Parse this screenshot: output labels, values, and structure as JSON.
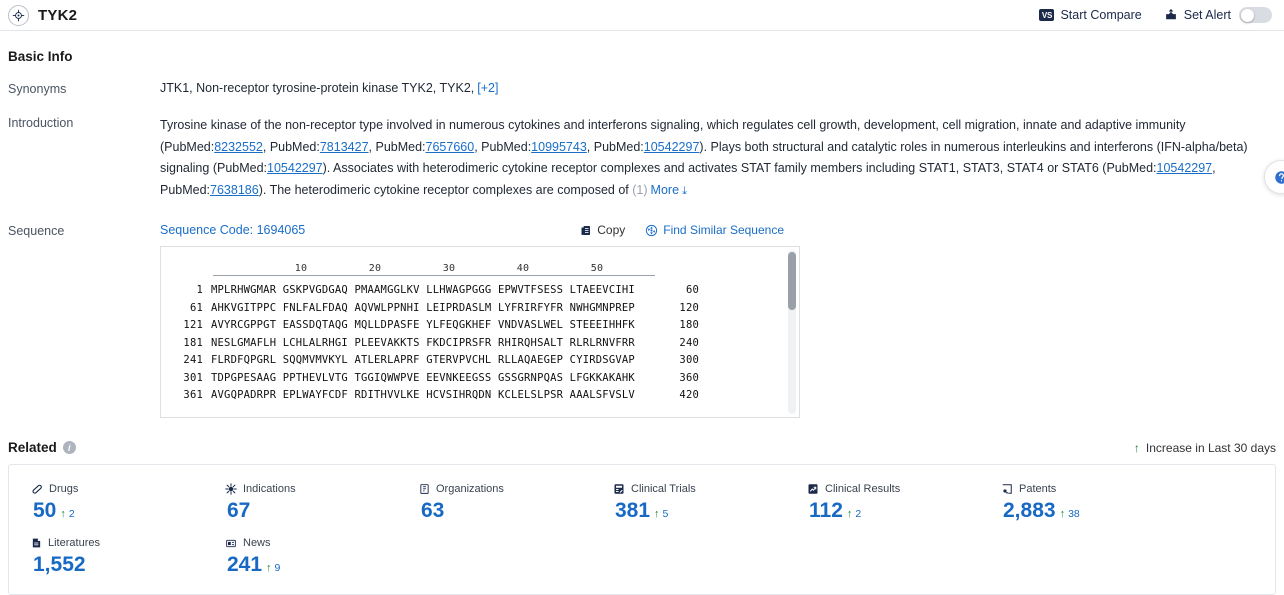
{
  "header": {
    "logo_icon": "target-crosshair-icon",
    "title": "TYK2",
    "actions": [
      {
        "label": "Start Compare",
        "icon": "vs-icon",
        "badge": "VS"
      },
      {
        "label": "Set Alert",
        "icon": "alert-bell-icon"
      }
    ],
    "alert_toggle_state": "off"
  },
  "basic_info": {
    "section_title": "Basic Info",
    "synonyms": {
      "label": "Synonyms",
      "value": "JTK1,  Non-receptor tyrosine-protein kinase TYK2,  TYK2,",
      "more_label": "[+2]"
    },
    "introduction": {
      "label": "Introduction",
      "text_1": "Tyrosine kinase of the non-receptor type involved in numerous cytokines and interferons signaling, which regulates cell growth, development, cell migration, innate and adaptive immunity (PubMed:",
      "ref_1": "8232552",
      "text_2": ", PubMed:",
      "ref_2": "7813427",
      "text_3": ", PubMed:",
      "ref_3": "7657660",
      "text_4": ", PubMed:",
      "ref_4": "10995743",
      "text_5": ", PubMed:",
      "ref_5": "10542297",
      "text_6": "). Plays both structural and catalytic roles in numerous interleukins and interferons (IFN-alpha/beta) signaling (PubMed:",
      "ref_6": "10542297",
      "text_7": "). Associates with heterodimeric cytokine receptor complexes and activates STAT family members including STAT1, STAT3, STAT4 or STAT6 (PubMed:",
      "ref_7": "10542297",
      "text_8": ", PubMed:",
      "ref_8": "7638186",
      "text_9": "). The heterodimeric cytokine receptor complexes are composed of ",
      "hidden_count": "(1)",
      "more_label": "More",
      "chevron": "chevron-double-down-icon"
    },
    "sequence": {
      "label": "Sequence",
      "code_label": "Sequence Code: 1694065",
      "copy_label": "Copy",
      "copy_icon": "copy-icon",
      "find_similar_label": "Find Similar Sequence",
      "find_similar_icon": "find-similar-icon",
      "ruler": [
        "10",
        "20",
        "30",
        "40",
        "50"
      ],
      "lines": [
        {
          "start": "1",
          "chunks": "MPLRHWGMAR GSKPVGDGAQ PMAAMGGLKV LLHWAGPGGG EPWVTFSESS LTAEEVCIHI",
          "end": "60"
        },
        {
          "start": "61",
          "chunks": "AHKVGITPPC FNLFALFDAQ AQVWLPPNHI LEIPRDASLM LYFRIRFYFR NWHGMNPREP",
          "end": "120"
        },
        {
          "start": "121",
          "chunks": "AVYRCGPPGT EASSDQTAQG MQLLDPASFE YLFEQGKHEF VNDVASLWEL STEEEIHHFK",
          "end": "180"
        },
        {
          "start": "181",
          "chunks": "NESLGMAFLH LCHLALRHGI PLEEVAKKTS FKDCIPRSFR RHIRQHSALT RLRLRNVFRR",
          "end": "240"
        },
        {
          "start": "241",
          "chunks": "FLRDFQPGRL SQQMVMVKYL ATLERLAPRF GTERVPVCHL RLLAQAEGEP CYIRDSGVAP",
          "end": "300"
        },
        {
          "start": "301",
          "chunks": "TDPGPESAAG PPTHEVLVTG TGGIQWWPVE EEVNKEEGSS GSSGRNPQAS LFGKKAKAHK",
          "end": "360"
        },
        {
          "start": "361",
          "chunks": "AVGQPADRPR EPLWAYFCDF RDITHVVLKE HCVSIHRQDN KCLELSLPSR AAALSFVSLV",
          "end": "420"
        }
      ]
    }
  },
  "related": {
    "section_title": "Related",
    "info_icon": "info-icon",
    "legend": "Increase in Last 30 days",
    "legend_icon": "up-arrow-icon",
    "stats": [
      {
        "label": "Drugs",
        "icon": "pill-icon",
        "value": "50",
        "delta": "2"
      },
      {
        "label": "Indications",
        "icon": "virus-icon",
        "value": "67",
        "delta": ""
      },
      {
        "label": "Organizations",
        "icon": "building-icon",
        "value": "63",
        "delta": ""
      },
      {
        "label": "Clinical Trials",
        "icon": "clinical-trial-icon",
        "value": "381",
        "delta": "5"
      },
      {
        "label": "Clinical Results",
        "icon": "clinical-result-icon",
        "value": "112",
        "delta": "2"
      },
      {
        "label": "Patents",
        "icon": "patent-icon",
        "value": "2,883",
        "delta": "38"
      },
      {
        "label": "Literatures",
        "icon": "literature-icon",
        "value": "1,552",
        "delta": ""
      },
      {
        "label": "News",
        "icon": "news-icon",
        "value": "241",
        "delta": "9"
      }
    ]
  },
  "colors": {
    "accent_link": "#1a6ec8",
    "stat_value": "#1769c4",
    "increase_green": "#1a8a3b",
    "dark_navy": "#1b2a4a"
  }
}
